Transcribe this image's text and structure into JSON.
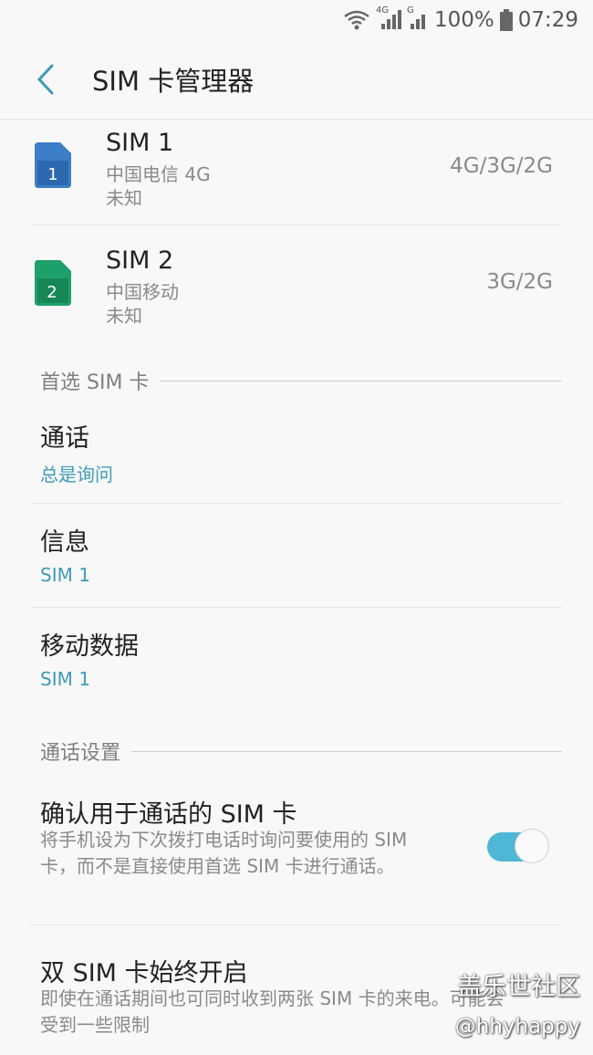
{
  "status_bar": {
    "battery_percent": "100%",
    "time": "07:29",
    "net_label_1": "4G",
    "net_label_2": "G"
  },
  "app_bar": {
    "title": "SIM 卡管理器"
  },
  "sims": [
    {
      "badge": "1",
      "name": "SIM 1",
      "carrier": "中国电信 4G",
      "status": "未知",
      "network": "4G/3G/2G",
      "color": "#3d7fc7"
    },
    {
      "badge": "2",
      "name": "SIM 2",
      "carrier": "中国移动",
      "status": "未知",
      "network": "3G/2G",
      "color": "#1ea06a"
    }
  ],
  "preferred_section": {
    "header": "首选 SIM 卡",
    "items": [
      {
        "title": "通话",
        "value": "总是询问"
      },
      {
        "title": "信息",
        "value": "SIM 1"
      },
      {
        "title": "移动数据",
        "value": "SIM 1"
      }
    ]
  },
  "call_settings": {
    "header": "通话设置",
    "confirm_sim": {
      "title": "确认用于通话的 SIM 卡",
      "desc": "将手机设为下次拨打电话时询问要使用的 SIM 卡，而不是直接使用首选 SIM 卡进行通话。",
      "enabled": true
    },
    "dual_always_on": {
      "title": "双 SIM 卡始终开启",
      "desc": "即使在通话期间也可同时收到两张 SIM 卡的来电。可能会受到一些限制"
    }
  },
  "watermark": {
    "line1": "盖乐世社区",
    "line2": "@hhyhappy"
  },
  "colors": {
    "accent": "#3f9bb6",
    "toggle_on": "#4fb7d6",
    "background": "#f8f8f8"
  }
}
